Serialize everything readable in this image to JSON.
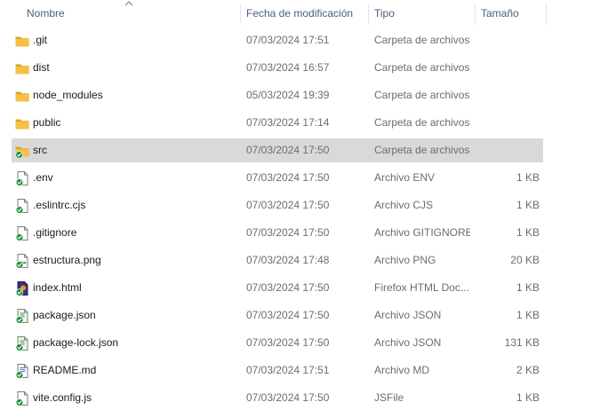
{
  "columns": {
    "name": "Nombre",
    "date": "Fecha de modificación",
    "type": "Tipo",
    "size": "Tamaño"
  },
  "colors": {
    "folder": "#f5c044",
    "folder_dark": "#dca22a",
    "check": "#1e8e3e",
    "selected_row": "#d9d9d9",
    "header_text": "#4c607a"
  },
  "files": [
    {
      "name": ".git",
      "date": "07/03/2024 17:51",
      "type": "Carpeta de archivos",
      "size": "",
      "icon": "folder-icon"
    },
    {
      "name": "dist",
      "date": "07/03/2024 16:57",
      "type": "Carpeta de archivos",
      "size": "",
      "icon": "folder-icon"
    },
    {
      "name": "node_modules",
      "date": "05/03/2024 19:39",
      "type": "Carpeta de archivos",
      "size": "",
      "icon": "folder-icon"
    },
    {
      "name": "public",
      "date": "07/03/2024 17:14",
      "type": "Carpeta de archivos",
      "size": "",
      "icon": "folder-icon"
    },
    {
      "name": "src",
      "date": "07/03/2024 17:50",
      "type": "Carpeta de archivos",
      "size": "",
      "icon": "folder-synced-icon",
      "selected": true
    },
    {
      "name": ".env",
      "date": "07/03/2024 17:50",
      "type": "Archivo ENV",
      "size": "1 KB",
      "icon": "file-synced-icon"
    },
    {
      "name": ".eslintrc.cjs",
      "date": "07/03/2024 17:50",
      "type": "Archivo CJS",
      "size": "1 KB",
      "icon": "file-synced-icon"
    },
    {
      "name": ".gitignore",
      "date": "07/03/2024 17:50",
      "type": "Archivo GITIGNORE",
      "size": "1 KB",
      "icon": "file-synced-icon"
    },
    {
      "name": "estructura.png",
      "date": "07/03/2024 17:48",
      "type": "Archivo PNG",
      "size": "20 KB",
      "icon": "image-synced-icon"
    },
    {
      "name": "index.html",
      "date": "07/03/2024 17:50",
      "type": "Firefox HTML Doc...",
      "size": "1 KB",
      "icon": "html-synced-icon"
    },
    {
      "name": "package.json",
      "date": "07/03/2024 17:50",
      "type": "Archivo JSON",
      "size": "1 KB",
      "icon": "json-synced-icon"
    },
    {
      "name": "package-lock.json",
      "date": "07/03/2024 17:50",
      "type": "Archivo JSON",
      "size": "131 KB",
      "icon": "json-synced-icon"
    },
    {
      "name": "README.md",
      "date": "07/03/2024 17:51",
      "type": "Archivo MD",
      "size": "2 KB",
      "icon": "text-synced-icon"
    },
    {
      "name": "vite.config.js",
      "date": "07/03/2024 17:50",
      "type": "JSFile",
      "size": "1 KB",
      "icon": "file-synced-icon"
    }
  ]
}
